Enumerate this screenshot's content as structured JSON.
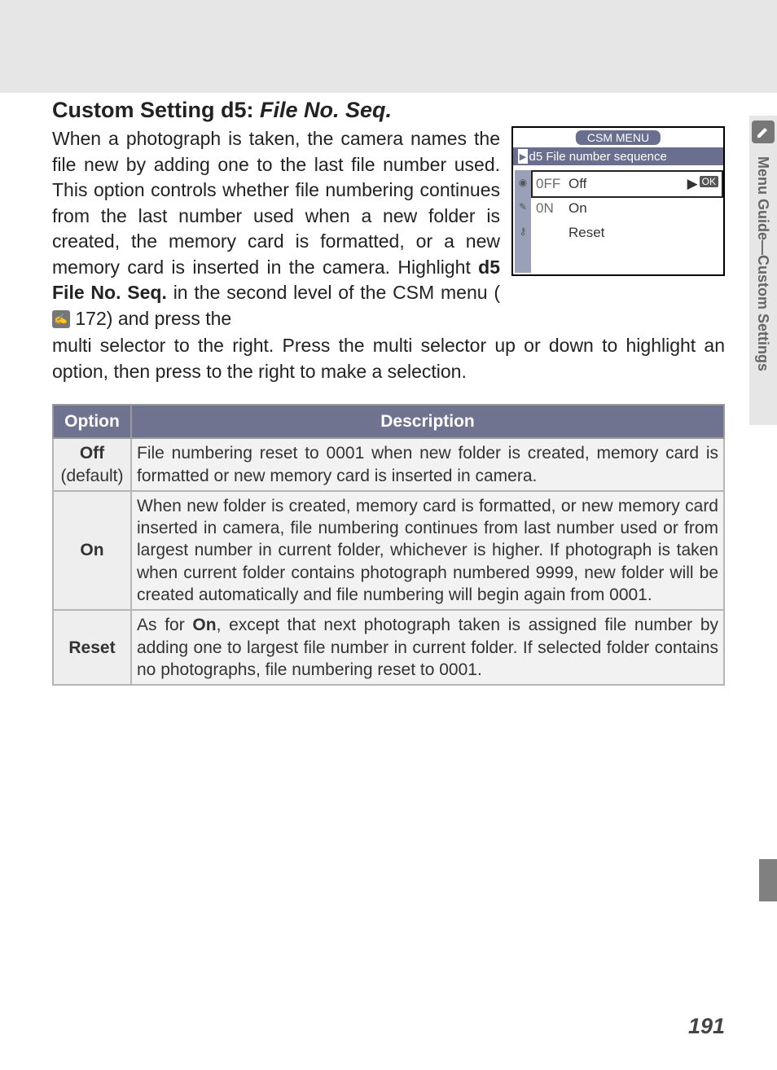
{
  "heading_prefix": "Custom Setting d5: ",
  "heading_italic": "File No. Seq.",
  "paragraph_1": "When a photograph is taken, the camera names the file new by adding one to the last file number used.  This option controls whether file numbering continues from the last number used when a new folder is created, the memory card is formatted, or a new memory card is inserted in the camera.  Highlight ",
  "paragraph_bold": "d5 File No. Seq.",
  "paragraph_2": " in the second level of the CSM menu (",
  "paragraph_ref": "172",
  "paragraph_3": ") and press the",
  "continuation": "multi selector to the right.  Press the multi selector up or down to highlight an option, then press to the right to make a selection.",
  "screenshot": {
    "menu_title": "CSM MENU",
    "subtitle_code": "d5",
    "subtitle_text": "File number sequence",
    "rows": [
      {
        "code": "0FF",
        "label": "Off",
        "ok": "OK"
      },
      {
        "code": "0N",
        "label": "On",
        "ok": ""
      },
      {
        "code": "",
        "label": "Reset",
        "ok": ""
      }
    ]
  },
  "table": {
    "headers": {
      "option": "Option",
      "description": "Description"
    },
    "rows": [
      {
        "option_main": "Off",
        "option_sub": "(default)",
        "desc": "File numbering reset to 0001 when new folder is created, memory card is formatted or new memory card is inserted in camera."
      },
      {
        "option_main": "On",
        "option_sub": "",
        "desc": "When new folder is created, memory card is formatted, or new memory card inserted in camera, file numbering continues from last number used or from largest number in current folder, whichever is higher.  If photograph is taken when current folder contains photograph numbered 9999, new folder will be created automatically and file numbering will begin again from 0001."
      },
      {
        "option_main": "Reset",
        "option_sub": "",
        "desc_pre": "As for ",
        "desc_bold": "On",
        "desc_post": ", except that next photograph taken is assigned file number by adding one to largest file number in current folder.  If selected folder contains no photographs, file numbering reset to 0001."
      }
    ]
  },
  "side_tab": "Menu Guide—Custom Settings",
  "page_number": "191"
}
